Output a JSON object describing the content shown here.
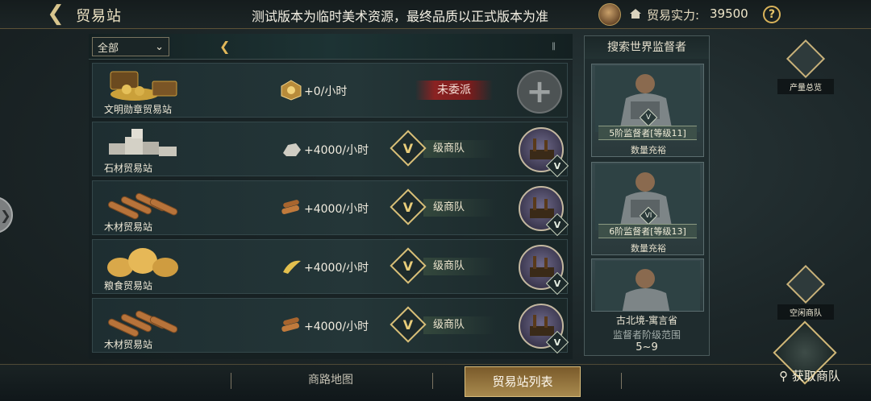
{
  "header": {
    "title": "贸易站",
    "notice": "测试版本为临时美术资源，最终品质以正式版本为准",
    "strength_label": "贸易实力:",
    "strength_value": "39500",
    "help": "?"
  },
  "filter": {
    "selected": "全部"
  },
  "stations": [
    {
      "name": "文明勋章贸易站",
      "rate": "+0/小时",
      "status": "未委派",
      "resource_icon": "medal-icon"
    },
    {
      "name": "石材贸易站",
      "rate": "+4000/小时",
      "grade": "V",
      "grade_label": "级商队",
      "caravan_rank": "V",
      "resource_icon": "stone-icon"
    },
    {
      "name": "木材贸易站",
      "rate": "+4000/小时",
      "grade": "V",
      "grade_label": "级商队",
      "caravan_rank": "V",
      "resource_icon": "wood-icon"
    },
    {
      "name": "粮食贸易站",
      "rate": "+4000/小时",
      "grade": "V",
      "grade_label": "级商队",
      "caravan_rank": "V",
      "resource_icon": "grain-icon"
    },
    {
      "name": "木材贸易站",
      "rate": "+4000/小时",
      "grade": "V",
      "grade_label": "级商队",
      "caravan_rank": "V",
      "resource_icon": "wood-icon"
    }
  ],
  "overseer": {
    "title": "搜索世界监督者",
    "cards": [
      {
        "rank": "V",
        "level": "5阶监督者[等级11]",
        "qty": "数量充裕"
      },
      {
        "rank": "VI",
        "level": "6阶监督者[等级13]",
        "qty": "数量充裕"
      }
    ],
    "region": "古北境-寓言省",
    "range_label": "监督者阶级范围",
    "range": "5~9"
  },
  "side": {
    "output_overview": "产量总览",
    "idle_caravan": "空闲商队"
  },
  "bottom": {
    "route_map": "商路地图",
    "station_list": "贸易站列表",
    "get_caravan": "获取商队"
  },
  "colors": {
    "accent_gold": "#d8bf78",
    "unassigned_red": "#8a2222",
    "active_tab": "#a88a4e"
  }
}
